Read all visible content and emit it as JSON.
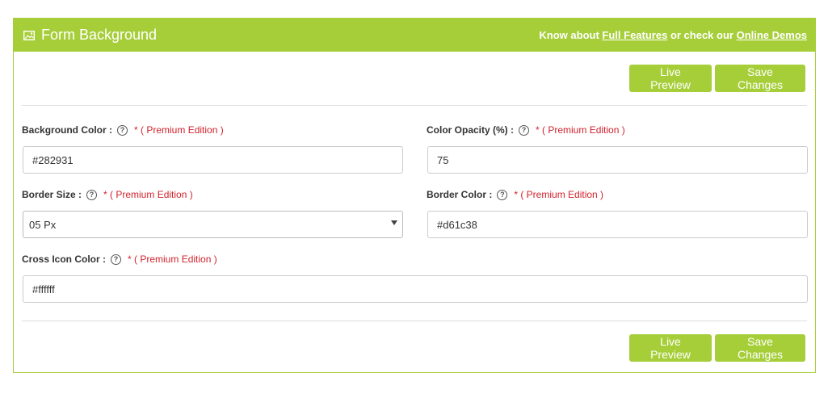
{
  "header": {
    "title": "Form Background",
    "icon": "image-icon",
    "links_prefix": "Know about ",
    "full_features": "Full Features",
    "links_middle": " or check our ",
    "online_demos": "Online Demos"
  },
  "toolbar": {
    "live_preview": "Live Preview",
    "save_changes": "Save Changes"
  },
  "fields": {
    "background_color": {
      "label": "Background Color :",
      "premium": "* ( Premium Edition )",
      "value": "#282931"
    },
    "color_opacity": {
      "label": "Color Opacity (%) :",
      "premium": "* ( Premium Edition )",
      "value": "75"
    },
    "border_size": {
      "label": "Border Size :",
      "premium": "* ( Premium Edition )",
      "value": "05 Px"
    },
    "border_color": {
      "label": "Border Color :",
      "premium": "* ( Premium Edition )",
      "value": "#d61c38"
    },
    "cross_icon_color": {
      "label": "Cross Icon Color :",
      "premium": "* ( Premium Edition )",
      "value": "#ffffff"
    }
  },
  "help_glyph": "?",
  "colors": {
    "accent": "#a6ce39",
    "premium": "#d0222c"
  }
}
